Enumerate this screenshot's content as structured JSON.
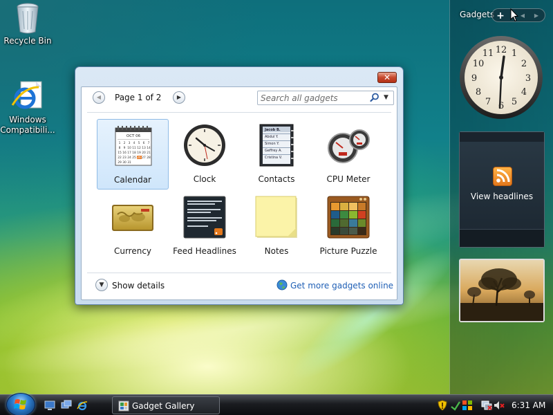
{
  "desktop": {
    "icons": [
      {
        "label": "Recycle Bin",
        "icon": "recycle-bin-icon"
      },
      {
        "label": "Windows Compatibili...",
        "icon": "internet-explorer-icon"
      }
    ]
  },
  "sidebar": {
    "title": "Gadgets",
    "controls": {
      "add": "+",
      "prev": "◀",
      "next": "▶"
    },
    "feed_gadget_label": "View headlines"
  },
  "gallery": {
    "close_label": "✕",
    "pager": {
      "prev": "◀",
      "label": "Page 1 of 2",
      "next": "▶"
    },
    "search": {
      "placeholder": "Search all gadgets",
      "value": ""
    },
    "gadgets": [
      {
        "label": "Calendar",
        "icon": "calendar-icon",
        "selected": true
      },
      {
        "label": "Clock",
        "icon": "clock-icon",
        "selected": false
      },
      {
        "label": "Contacts",
        "icon": "contacts-icon",
        "selected": false
      },
      {
        "label": "CPU Meter",
        "icon": "cpu-meter-icon",
        "selected": false
      },
      {
        "label": "Currency",
        "icon": "currency-icon",
        "selected": false
      },
      {
        "label": "Feed Headlines",
        "icon": "feed-headlines-icon",
        "selected": false
      },
      {
        "label": "Notes",
        "icon": "notes-icon",
        "selected": false
      },
      {
        "label": "Picture Puzzle",
        "icon": "picture-puzzle-icon",
        "selected": false
      }
    ],
    "show_details": "Show details",
    "get_more": "Get more gadgets online",
    "calendar_thumb": {
      "month": "OCT 06",
      "highlight_day": "26"
    },
    "contacts_thumb": {
      "names": [
        "Jacob B.",
        "Abdul Y.",
        "Simon Y.",
        "Geffrey A.",
        "Cristina V."
      ]
    }
  },
  "taskbar": {
    "task_label": "Gadget Gallery",
    "time": "6:31 AM"
  },
  "colors": {
    "accent": "#1f5fb5",
    "selection": "#cfe6fb",
    "close_red": "#c74a2e",
    "feed_orange": "#e3781c"
  }
}
